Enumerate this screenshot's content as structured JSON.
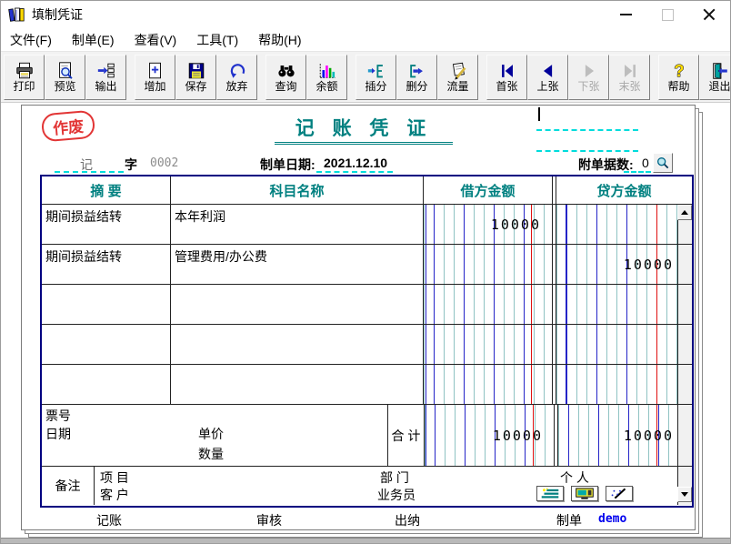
{
  "window": {
    "title": "填制凭证"
  },
  "menu": {
    "items": [
      {
        "label": "文件(F)"
      },
      {
        "label": "制单(E)"
      },
      {
        "label": "查看(V)"
      },
      {
        "label": "工具(T)"
      },
      {
        "label": "帮助(H)"
      }
    ]
  },
  "toolbar": {
    "buttons": [
      {
        "label": "打印",
        "icon": "printer-icon",
        "enabled": true
      },
      {
        "label": "预览",
        "icon": "preview-icon",
        "enabled": true
      },
      {
        "label": "输出",
        "icon": "export-icon",
        "enabled": true
      },
      {
        "label": "增加",
        "icon": "add-icon",
        "enabled": true
      },
      {
        "label": "保存",
        "icon": "save-icon",
        "enabled": true
      },
      {
        "label": "放弃",
        "icon": "undo-icon",
        "enabled": true
      },
      {
        "label": "查询",
        "icon": "search-icon",
        "enabled": true
      },
      {
        "label": "余额",
        "icon": "balance-chart-icon",
        "enabled": true
      },
      {
        "label": "插分",
        "icon": "insert-entry-icon",
        "enabled": true
      },
      {
        "label": "删分",
        "icon": "delete-entry-icon",
        "enabled": true
      },
      {
        "label": "流量",
        "icon": "cashflow-icon",
        "enabled": true
      },
      {
        "label": "首张",
        "icon": "first-page-icon",
        "enabled": true
      },
      {
        "label": "上张",
        "icon": "prev-page-icon",
        "enabled": true
      },
      {
        "label": "下张",
        "icon": "next-page-icon",
        "enabled": false
      },
      {
        "label": "末张",
        "icon": "last-page-icon",
        "enabled": false
      },
      {
        "label": "帮助",
        "icon": "help-icon",
        "enabled": true
      },
      {
        "label": "退出",
        "icon": "exit-icon",
        "enabled": true
      }
    ]
  },
  "voucher": {
    "void_stamp": "作废",
    "title": "记 账 凭 证",
    "word": {
      "prefix": "记",
      "suffix": "字",
      "number": "0002"
    },
    "date": {
      "label": "制单日期:",
      "value": "2021.12.10"
    },
    "attachments": {
      "label": "附单据数:",
      "count": "0"
    },
    "table": {
      "headers": {
        "summary": "摘 要",
        "account": "科目名称",
        "debit": "借方金额",
        "credit": "贷方金额"
      },
      "rows": [
        {
          "summary": "期间损益结转",
          "account": "本年利润",
          "debit": "10000",
          "credit": ""
        },
        {
          "summary": "期间损益结转",
          "account": "管理费用/办公费",
          "debit": "",
          "credit": "10000"
        },
        {
          "summary": "",
          "account": "",
          "debit": "",
          "credit": ""
        },
        {
          "summary": "",
          "account": "",
          "debit": "",
          "credit": ""
        },
        {
          "summary": "",
          "account": "",
          "debit": "",
          "credit": ""
        }
      ],
      "bill": {
        "ticket_label": "票号",
        "date_label": "日期",
        "unit_price_label": "单价",
        "quantity_label": "数量",
        "total_label": "合 计",
        "total_debit": "10000",
        "total_credit": "10000"
      },
      "remarks": {
        "label": "备注",
        "project_label": "项 目",
        "customer_label": "客 户",
        "department_label": "部 门",
        "salesman_label": "业务员",
        "person_label": "个 人"
      }
    },
    "signatures": {
      "bookkeeper_label": "记账",
      "auditor_label": "审核",
      "cashier_label": "出纳",
      "maker_label": "制单",
      "maker_value": "demo"
    }
  },
  "colors": {
    "accent_teal": "#008080",
    "table_border": "#000080",
    "void_red": "#e23535",
    "dash_cyan": "#00dcdc",
    "maker_blue": "#0000ee",
    "ledger_blue": "#2424c8",
    "ledger_red": "#e01010"
  }
}
